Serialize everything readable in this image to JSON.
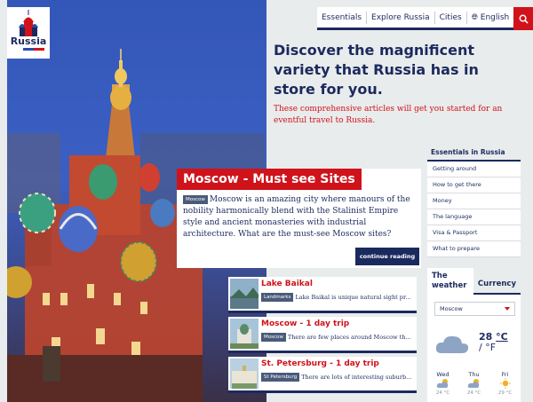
{
  "logo": {
    "text": "Russia"
  },
  "nav": {
    "items": [
      "Essentials",
      "Explore Russia",
      "Cities"
    ],
    "language": "English"
  },
  "hero": {
    "headline": "Discover the magnificent variety that Russia has in store for you.",
    "subtext": "These comprehensive articles will get you started for an eventful travel to Russia."
  },
  "feature": {
    "title": "Moscow - Must see Sites",
    "tag": "Moscow",
    "body": "Moscow is an amazing city where manours of the nobility harmonically blend with the Stalinist Empire style and ancient monasteries with industrial architecture. What are the must-see Moscow sites?",
    "cta": "continue reading"
  },
  "cards": [
    {
      "title": "Lake Baikal",
      "tag": "Landmarks",
      "snippet": "Lake Baikal is unique natural sight pr..."
    },
    {
      "title": "Moscow - 1 day trip",
      "tag": "Moscow",
      "snippet": "There are few places around Moscow th..."
    },
    {
      "title": "St. Petersburg - 1 day trip",
      "tag": "St Petersburg",
      "snippet": "There are lots of interesting suburb..."
    }
  ],
  "sidebar": {
    "heading": "Essentials in Russia",
    "items": [
      "Getting around",
      "How to get there",
      "Money",
      "The language",
      "Visa & Passport",
      "What to prepare"
    ]
  },
  "weather": {
    "tab_weather": "The weather",
    "tab_currency": "Currency",
    "city": "Moscow",
    "temp_value": "28",
    "temp_unit_c": "°C",
    "temp_unit_f": "/ °F",
    "days": [
      {
        "name": "Wed",
        "temp": "24 °C"
      },
      {
        "name": "Thu",
        "temp": "24 °C"
      },
      {
        "name": "Fri",
        "temp": "29 °C"
      }
    ]
  },
  "colors": {
    "navy": "#1b2a5e",
    "red": "#d0121a",
    "bg": "#e9ecec"
  },
  "icons": [
    "search-icon",
    "globe-icon",
    "cloud-icon",
    "partly-cloudy-icon",
    "sun-icon",
    "chevron-down-icon"
  ]
}
